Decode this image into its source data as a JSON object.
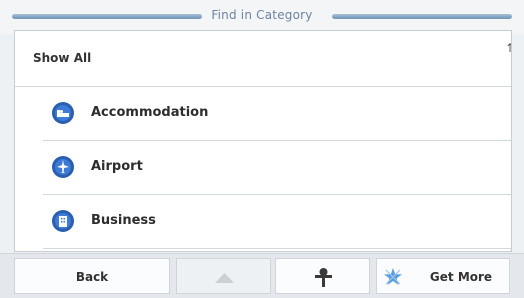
{
  "window": {
    "title": "Find in Category"
  },
  "list": {
    "show_all_label": "Show All",
    "scroll_indicator": "↑",
    "items": [
      {
        "label": "Accommodation",
        "icon": "bed-icon",
        "color": "#2a5fb0"
      },
      {
        "label": "Airport",
        "icon": "airplane-icon",
        "color": "#2a5fb0"
      },
      {
        "label": "Business",
        "icon": "business-icon",
        "color": "#2a5fb0"
      }
    ]
  },
  "toolbar": {
    "back_label": "Back",
    "up_icon": "up-arrow-icon",
    "pin_icon": "pin-icon",
    "get_more_label": "Get More",
    "get_more_icon": "star-icon"
  }
}
